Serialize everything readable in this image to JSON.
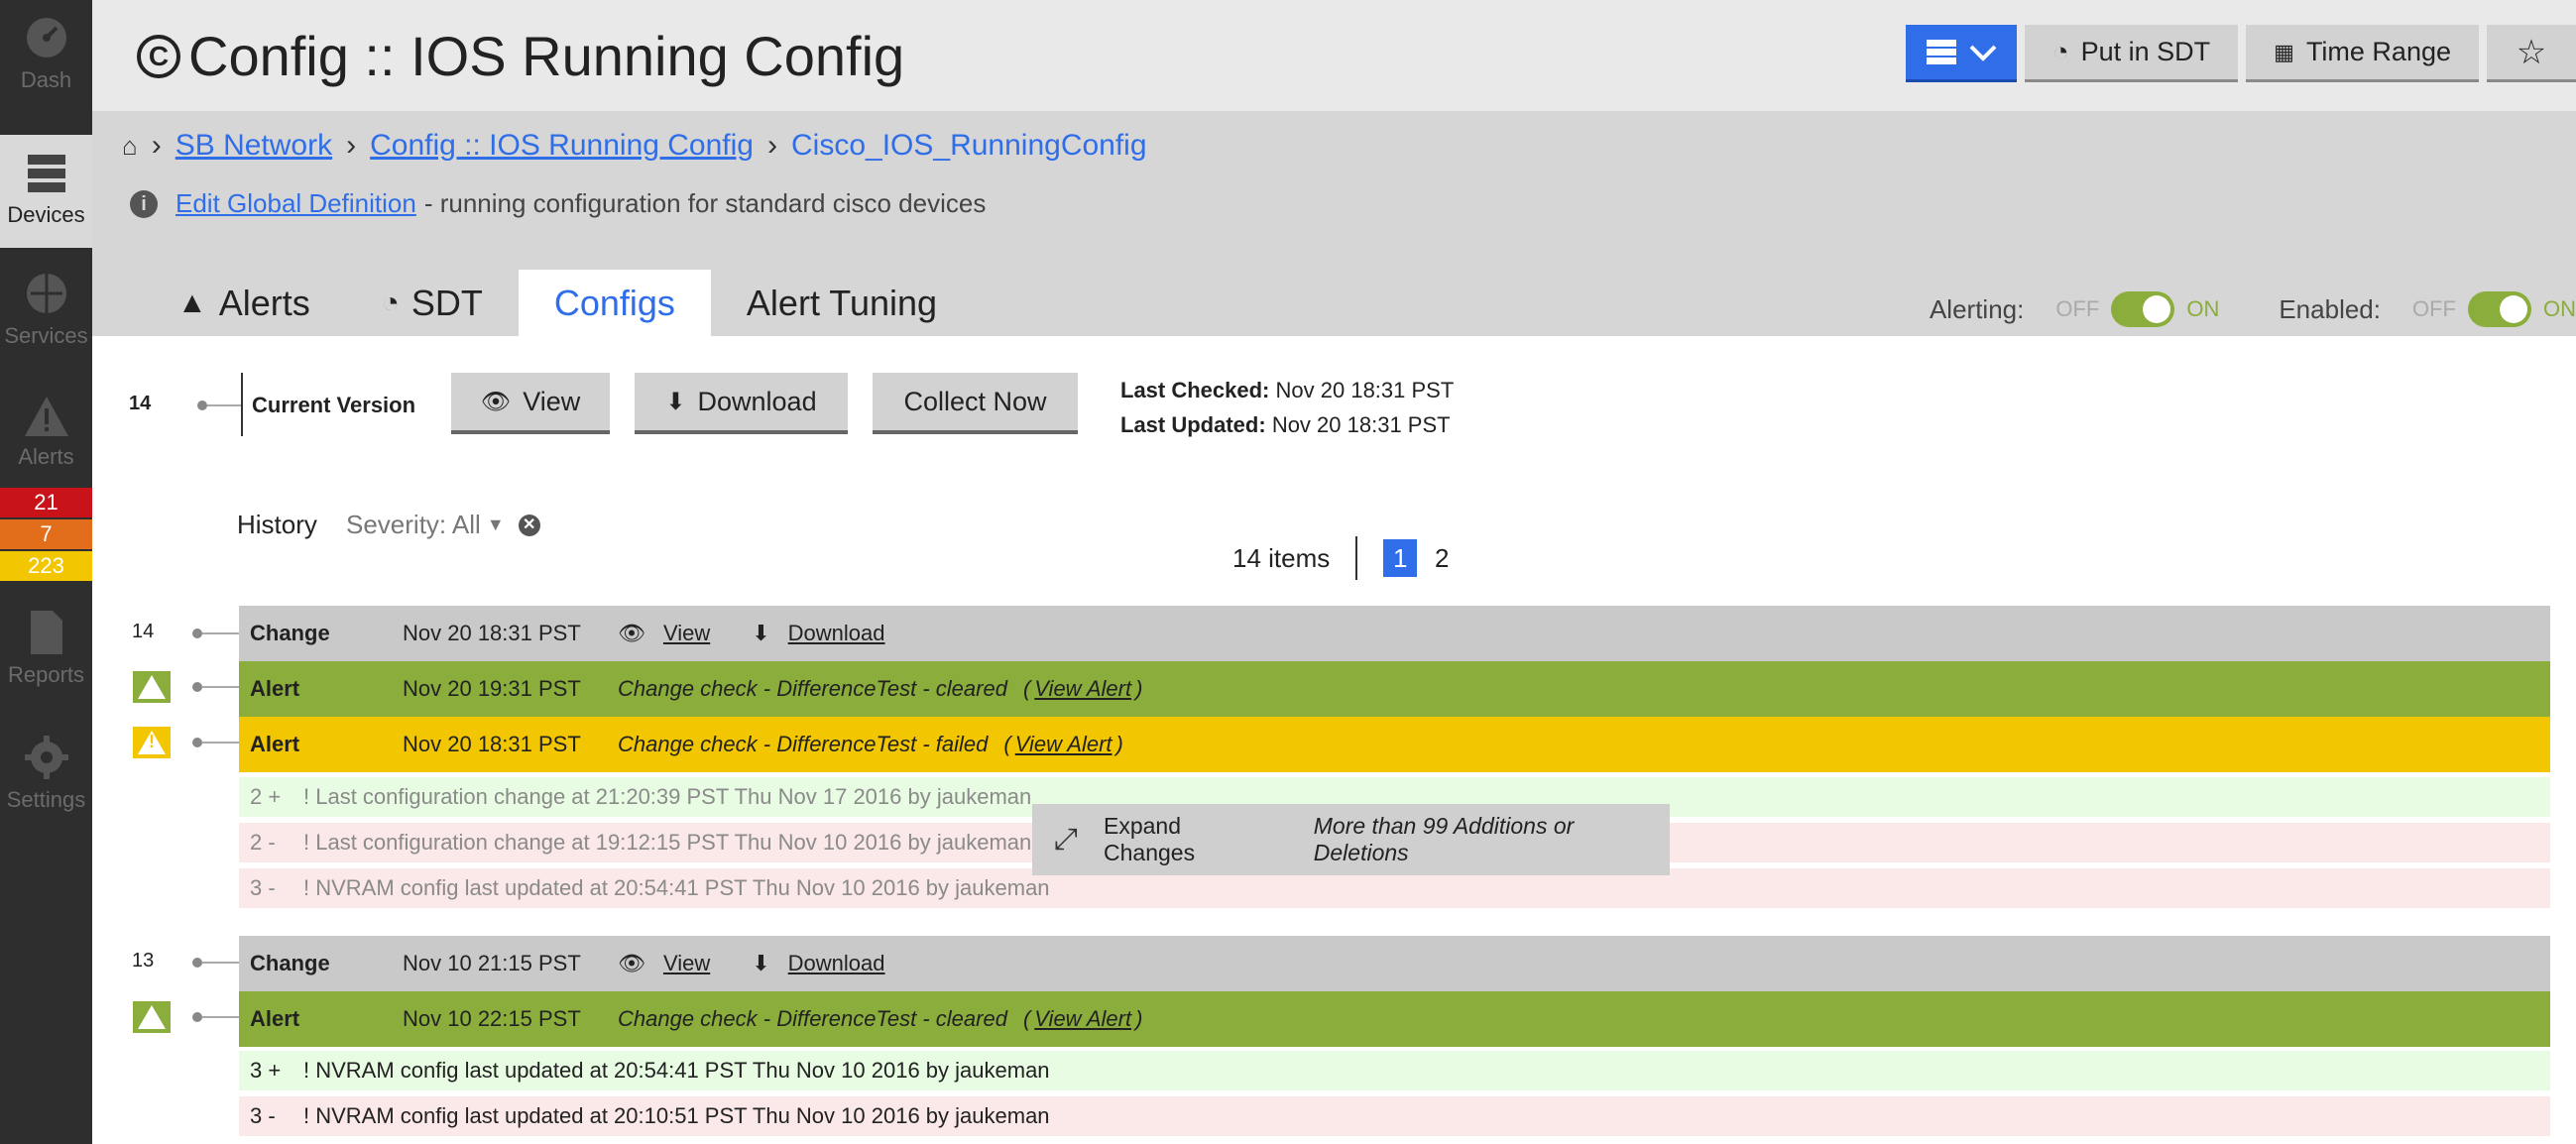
{
  "nav": {
    "items": [
      {
        "label": "Dash",
        "icon": "dashboard-icon"
      },
      {
        "label": "Devices",
        "icon": "devices-icon"
      },
      {
        "label": "Services",
        "icon": "services-icon"
      },
      {
        "label": "Alerts",
        "icon": "alert-icon"
      },
      {
        "label": "Reports",
        "icon": "reports-icon"
      },
      {
        "label": "Settings",
        "icon": "gear-icon"
      }
    ],
    "alert_counts": [
      {
        "value": "21",
        "color": "#c9131a"
      },
      {
        "value": "7",
        "color": "#e26d1a"
      },
      {
        "value": "223",
        "color": "#f2c600"
      }
    ]
  },
  "header": {
    "title": "Config :: IOS Running Config",
    "buttons": {
      "sdt": "Put in SDT",
      "time_range": "Time Range",
      "star": "☆"
    }
  },
  "breadcrumb": {
    "items": [
      "SB Network",
      "Config :: IOS Running Config"
    ],
    "current": "Cisco_IOS_RunningConfig"
  },
  "description": {
    "link": "Edit Global Definition",
    "text": "- running configuration for standard cisco devices"
  },
  "tabs": [
    "Alerts",
    "SDT",
    "Configs",
    "Alert Tuning"
  ],
  "active_tab": "Configs",
  "toggles": [
    {
      "label": "Alerting:",
      "off": "OFF",
      "on": "ON",
      "state": "on"
    },
    {
      "label": "Enabled:",
      "off": "OFF",
      "on": "ON",
      "state": "on"
    }
  ],
  "current_version": {
    "number": "14",
    "label": "Current Version",
    "buttons": {
      "view": "View",
      "download": "Download",
      "collect": "Collect Now"
    },
    "last_checked_label": "Last Checked:",
    "last_checked": "Nov 20 18:31 PST",
    "last_updated_label": "Last Updated:",
    "last_updated": "Nov 20 18:31 PST"
  },
  "history": {
    "label": "History",
    "severity_label": "Severity: All",
    "items_count": "14 items",
    "pages": [
      "1",
      "2"
    ],
    "current_page": "1",
    "groups": [
      {
        "number": "14",
        "change": {
          "type": "Change",
          "time": "Nov 20 18:31 PST",
          "view": "View",
          "download": "Download"
        },
        "alerts": [
          {
            "type": "Alert",
            "time": "Nov 20 19:31 PST",
            "text": "Change check - DifferenceTest - cleared",
            "link": "View Alert",
            "severity": "cleared"
          },
          {
            "type": "Alert",
            "time": "Nov 20 18:31 PST",
            "text": "Change check - DifferenceTest - failed",
            "link": "View Alert",
            "severity": "warning"
          }
        ],
        "diffs": [
          {
            "line": "2 +",
            "text": "! Last configuration change at 21:20:39 PST Thu Nov 17 2016 by jaukeman",
            "kind": "add"
          },
          {
            "line": "2 -",
            "text": "! Last configuration change at 19:12:15 PST Thu Nov 10 2016 by jaukeman",
            "kind": "del"
          },
          {
            "line": "3 -",
            "text": "! NVRAM config last updated at 20:54:41 PST Thu Nov 10 2016 by jaukeman",
            "kind": "del"
          }
        ],
        "expand": {
          "label": "Expand Changes",
          "note": "More than 99 Additions or Deletions"
        }
      },
      {
        "number": "13",
        "change": {
          "type": "Change",
          "time": "Nov 10 21:15 PST",
          "view": "View",
          "download": "Download"
        },
        "alerts": [
          {
            "type": "Alert",
            "time": "Nov 10 22:15 PST",
            "text": "Change check - DifferenceTest - cleared",
            "link": "View Alert",
            "severity": "cleared"
          }
        ],
        "diffs": [
          {
            "line": "3 +",
            "text": "! NVRAM config last updated at 20:54:41 PST Thu Nov 10 2016 by jaukeman",
            "kind": "add"
          },
          {
            "line": "3 -",
            "text": "! NVRAM config last updated at 20:10:51 PST Thu Nov 10 2016 by jaukeman",
            "kind": "del"
          }
        ]
      }
    ]
  },
  "colors": {
    "accent": "#2f6ee8",
    "alert_green": "#8aad3b",
    "alert_yellow": "#f2c600",
    "change_grey": "#c9c9c9",
    "diff_add": "#e8fbe3",
    "diff_del": "#fbe8e8"
  }
}
